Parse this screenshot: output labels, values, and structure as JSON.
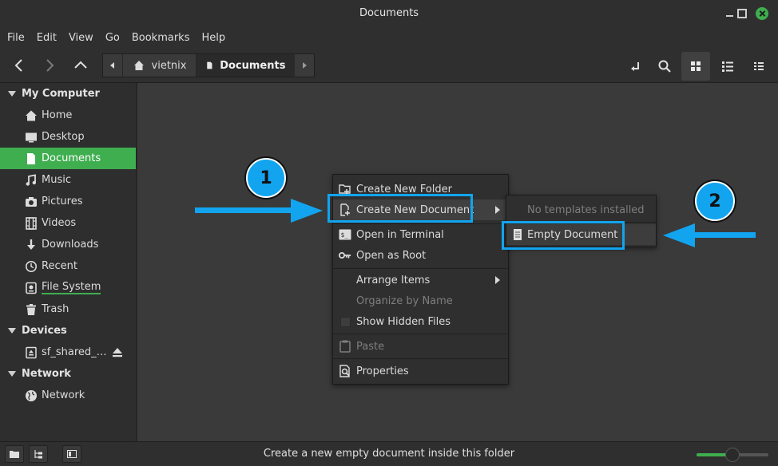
{
  "window": {
    "title": "Documents"
  },
  "menubar": {
    "items": [
      "File",
      "Edit",
      "View",
      "Go",
      "Bookmarks",
      "Help"
    ]
  },
  "breadcrumb": {
    "items": [
      "vietnix",
      "Documents"
    ]
  },
  "sidebar": {
    "sections": [
      {
        "title": "My Computer",
        "items": [
          {
            "label": "Home",
            "icon": "home-icon"
          },
          {
            "label": "Desktop",
            "icon": "desktop-icon"
          },
          {
            "label": "Documents",
            "icon": "document-icon",
            "active": true
          },
          {
            "label": "Music",
            "icon": "music-icon"
          },
          {
            "label": "Pictures",
            "icon": "camera-icon"
          },
          {
            "label": "Videos",
            "icon": "film-icon"
          },
          {
            "label": "Downloads",
            "icon": "download-icon"
          },
          {
            "label": "Recent",
            "icon": "clock-icon"
          },
          {
            "label": "File System",
            "icon": "drive-icon"
          },
          {
            "label": "Trash",
            "icon": "trash-icon"
          }
        ]
      },
      {
        "title": "Devices",
        "items": [
          {
            "label": "sf_shared_…",
            "icon": "usb-drive-icon"
          }
        ]
      },
      {
        "title": "Network",
        "items": [
          {
            "label": "Network",
            "icon": "globe-icon"
          }
        ]
      }
    ]
  },
  "context_menu": {
    "items": [
      {
        "label": "Create New Folder",
        "icon": "new-folder-icon"
      },
      {
        "label": "Create New Document",
        "icon": "new-document-icon",
        "submenu": true
      },
      {
        "label": "Open in Terminal",
        "icon": "terminal-icon"
      },
      {
        "label": "Open as Root",
        "icon": "key-icon"
      },
      {
        "label": "Arrange Items",
        "submenu": true
      },
      {
        "label": "Organize by Name",
        "disabled": true
      },
      {
        "label": "Show Hidden Files",
        "checkbox": true
      },
      {
        "label": "Paste",
        "icon": "clipboard-icon",
        "disabled": true
      },
      {
        "label": "Properties",
        "icon": "properties-icon"
      }
    ]
  },
  "submenu": {
    "no_templates": "No templates installed",
    "empty_document": "Empty Document"
  },
  "annotations": {
    "step1": "1",
    "step2": "2"
  },
  "status": {
    "text": "Create a new empty document inside this folder",
    "zoom_fraction": 0.5
  },
  "colors": {
    "accent": "#3fae4f",
    "annotation": "#12a4ef"
  }
}
